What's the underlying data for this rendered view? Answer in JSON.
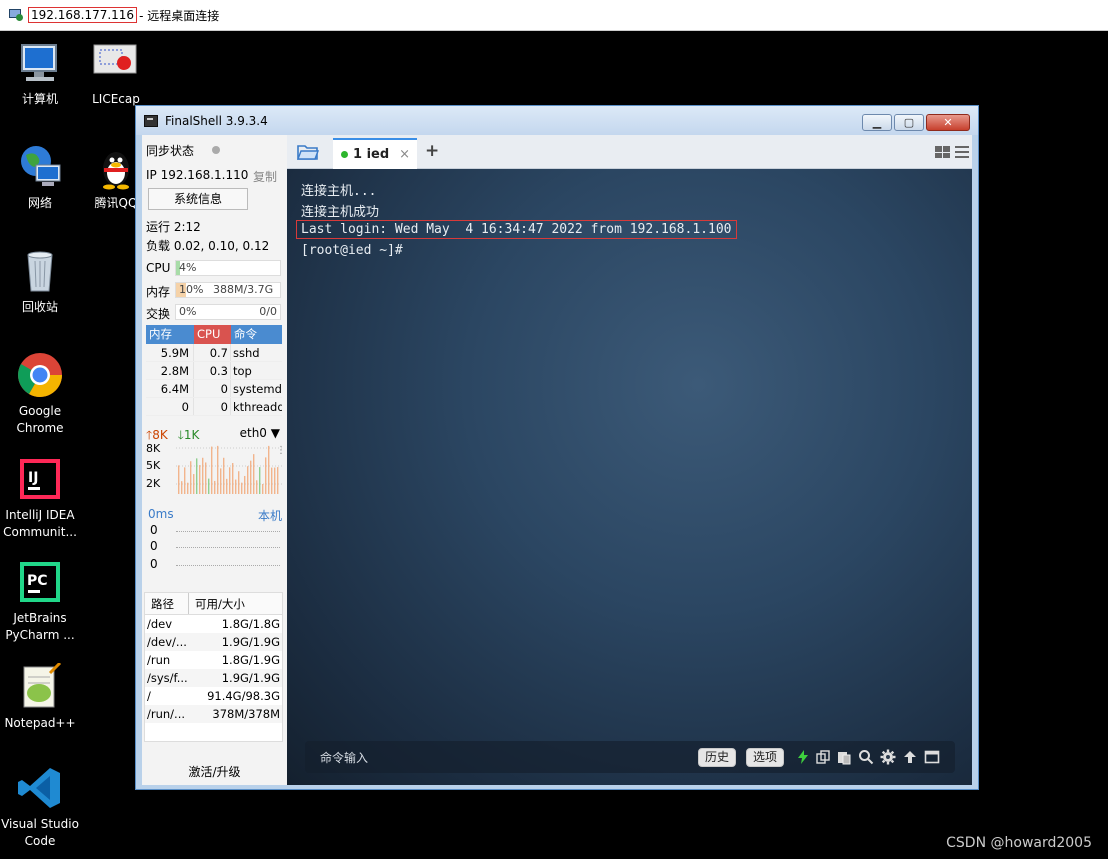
{
  "rdp": {
    "ip": "192.168.177.116",
    "title_suffix": "- 远程桌面连接"
  },
  "desktop": {
    "icons": [
      {
        "label": "计算机"
      },
      {
        "label": "LICEcap"
      },
      {
        "label": "网络"
      },
      {
        "label": "腾讯QQ"
      },
      {
        "label": "回收站"
      },
      {
        "label": "Google Chrome"
      },
      {
        "label": "IntelliJ IDEA Communit..."
      },
      {
        "label": "JetBrains PyCharm ..."
      },
      {
        "label": "Notepad++"
      },
      {
        "label": "Visual Studio Code"
      }
    ],
    "watermark": "CSDN @howard2005"
  },
  "finalshell": {
    "title": "FinalShell 3.9.3.4",
    "sync_label": "同步状态",
    "ip_label": "IP 192.168.1.110",
    "copy_label": "复制",
    "sysinfo_label": "系统信息",
    "uptime": "运行 2:12",
    "load": "负载 0.02, 0.10, 0.12",
    "cpu": {
      "label": "CPU",
      "value": "4%",
      "percent": 4
    },
    "mem": {
      "label": "内存",
      "value": "10%",
      "detail": "388M/3.7G",
      "percent": 10
    },
    "swap": {
      "label": "交换",
      "value": "0%",
      "detail": "0/0",
      "percent": 0
    },
    "proc_headers": {
      "mem": "内存",
      "cpu": "CPU",
      "cmd": "命令"
    },
    "procs": [
      {
        "mem": "5.9M",
        "cpu": "0.7",
        "cmd": "sshd"
      },
      {
        "mem": "2.8M",
        "cpu": "0.3",
        "cmd": "top"
      },
      {
        "mem": "6.4M",
        "cpu": "0",
        "cmd": "systemd"
      },
      {
        "mem": "0",
        "cpu": "0",
        "cmd": "kthreadd"
      }
    ],
    "net": {
      "up": "8K",
      "down": "1K",
      "iface": "eth0",
      "ticks": [
        "8K",
        "5K",
        "2K"
      ]
    },
    "ping": {
      "label": "0ms",
      "target": "本机",
      "ticks": [
        "0",
        "0",
        "0"
      ]
    },
    "fs_headers": {
      "path": "路径",
      "avail": "可用/大小"
    },
    "filesystems": [
      {
        "path": "/dev",
        "size": "1.8G/1.8G"
      },
      {
        "path": "/dev/...",
        "size": "1.9G/1.9G"
      },
      {
        "path": "/run",
        "size": "1.8G/1.9G"
      },
      {
        "path": "/sys/f...",
        "size": "1.9G/1.9G"
      },
      {
        "path": "/",
        "size": "91.4G/98.3G"
      },
      {
        "path": "/run/...",
        "size": "378M/378M"
      }
    ],
    "activate_label": "激活/升级",
    "tab": {
      "label": "1 ied",
      "close": "×"
    },
    "terminal": {
      "lines": [
        "连接主机...",
        "连接主机成功",
        "Last login: Wed May  4 16:34:47 2022 from 192.168.1.100",
        "[root@ied ~]#"
      ]
    },
    "cmdbar": {
      "placeholder": "命令输入",
      "history_label": "历史",
      "options_label": "选项"
    },
    "colors": {
      "proc_mem_header": "#4a8bd0",
      "proc_cpu_header": "#d9534f",
      "proc_cmd_header": "#4a8bd0",
      "up_color": "#cc4400",
      "down_color": "#2a8a2a",
      "accent": "#3a8ee6"
    }
  }
}
